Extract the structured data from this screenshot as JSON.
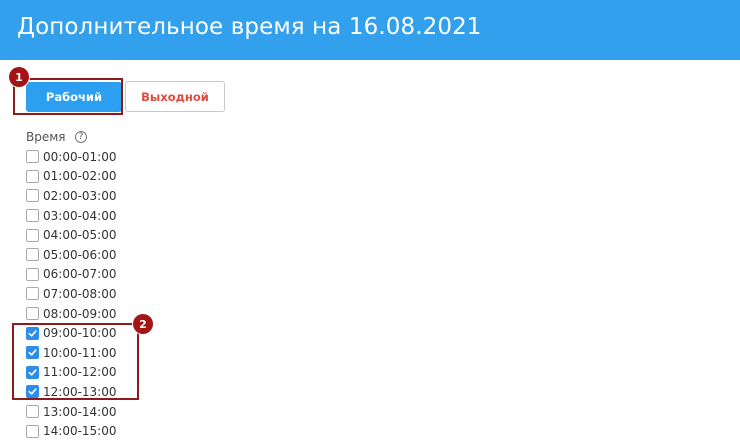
{
  "header": {
    "title": "Дополнительное время на 16.08.2021"
  },
  "day_type": {
    "work_label": "Рабочий",
    "weekend_label": "Выходной",
    "selected": "work"
  },
  "time_section": {
    "label": "Время",
    "help_glyph": "?"
  },
  "callouts": [
    "1",
    "2"
  ],
  "slots": [
    {
      "label": "00:00-01:00",
      "checked": false
    },
    {
      "label": "01:00-02:00",
      "checked": false
    },
    {
      "label": "02:00-03:00",
      "checked": false
    },
    {
      "label": "03:00-04:00",
      "checked": false
    },
    {
      "label": "04:00-05:00",
      "checked": false
    },
    {
      "label": "05:00-06:00",
      "checked": false
    },
    {
      "label": "06:00-07:00",
      "checked": false
    },
    {
      "label": "07:00-08:00",
      "checked": false
    },
    {
      "label": "08:00-09:00",
      "checked": false
    },
    {
      "label": "09:00-10:00",
      "checked": true
    },
    {
      "label": "10:00-11:00",
      "checked": true
    },
    {
      "label": "11:00-12:00",
      "checked": true
    },
    {
      "label": "12:00-13:00",
      "checked": true
    },
    {
      "label": "13:00-14:00",
      "checked": false
    },
    {
      "label": "14:00-15:00",
      "checked": false
    }
  ],
  "colors": {
    "header": "#33a0ee",
    "primary_button": "#2d9ff0",
    "weekend_text": "#e34a3e",
    "callout": "#a31414",
    "checkbox_checked": "#2d8ee8"
  }
}
